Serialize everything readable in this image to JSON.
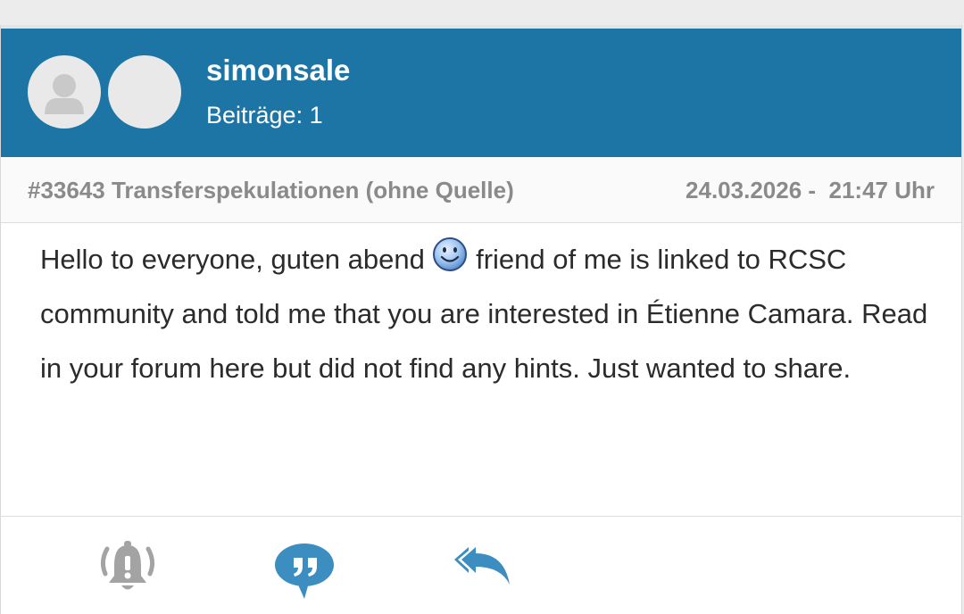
{
  "post": {
    "author": {
      "username": "simonsale",
      "post_count_label": "Beiträge: 1"
    },
    "meta": {
      "thread": "#33643 Transferspekulationen (ohne Quelle)",
      "date": "24.03.2026 -  21:47 Uhr"
    },
    "content": {
      "part1": "Hello to everyone, guten abend ",
      "part2": " friend of me is linked to RCSC community and told me that you are interested in Étienne Camara. Read in your forum here but did not find any hints. Just wanted to share."
    },
    "actions": {
      "report_icon": "alarm-bell-icon",
      "quote_icon": "quote-bubble-icon",
      "reply_icon": "reply-all-icon"
    }
  },
  "colors": {
    "header_bg": "#1d75a6",
    "action_blue": "#3c8dc0",
    "action_gray": "#a3a3a3"
  }
}
